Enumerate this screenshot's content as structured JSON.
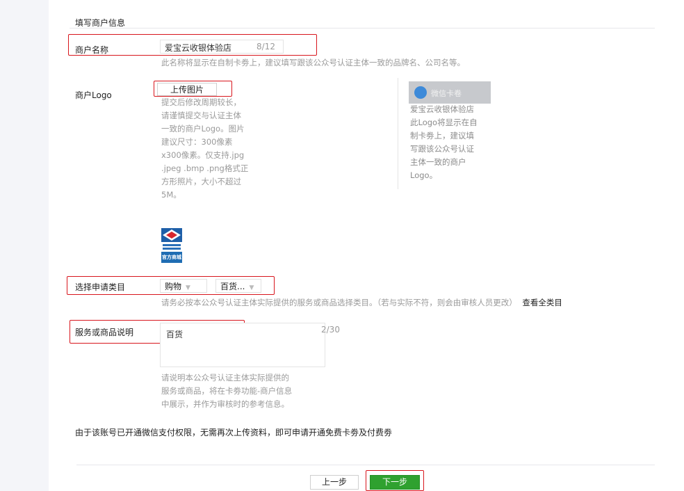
{
  "section": {
    "title": "填写商户信息"
  },
  "merchant_name": {
    "label": "商户名称",
    "value": "爱宝云收银体验店",
    "counter": "8/12",
    "hint": "此名称将显示在自制卡劵上，建议填写跟该公众号认证主体一致的品牌名、公司名等。"
  },
  "merchant_logo": {
    "label": "商户Logo",
    "upload_button": "上传图片",
    "hint_lines": [
      "提交后修改周期较长，",
      "请谨慎提交与认证主体",
      "一致的商户Logo。图片",
      "建议尺寸：300像素",
      "x300像素。仅支持.jpg",
      ".jpeg .bmp .png格式正",
      "方形照片，大小不超过",
      "5M。"
    ],
    "logo_caption": "官方商城",
    "preview": {
      "card_title": "微信卡卷",
      "lines": [
        "爱宝云收银体验店",
        "此Logo将显示在自",
        "制卡劵上，建议填",
        "写跟该公众号认证",
        "主体一致的商户",
        "Logo。"
      ]
    }
  },
  "category": {
    "label": "选择申请类目",
    "select1": "购物",
    "select2": "百货...",
    "hint": "请务必按本公众号认证主体实际提供的服务或商品选择类目。（若与实际不符，则会由审核人员更改）",
    "link": "查看全类目"
  },
  "service_desc": {
    "label": "服务或商品说明",
    "value": "百货",
    "counter": "2/30",
    "hint_lines": [
      "请说明本公众号认证主体实际提供的",
      "服务或商品，将在卡劵功能-商户信息",
      "中展示，并作为审核时的参考信息。"
    ]
  },
  "notice": "由于该账号已开通微信支付权限，无需再次上传资料，即可申请开通免费卡劵及付费劵",
  "footer": {
    "prev_button": "上一步",
    "next_button": "下一步"
  }
}
